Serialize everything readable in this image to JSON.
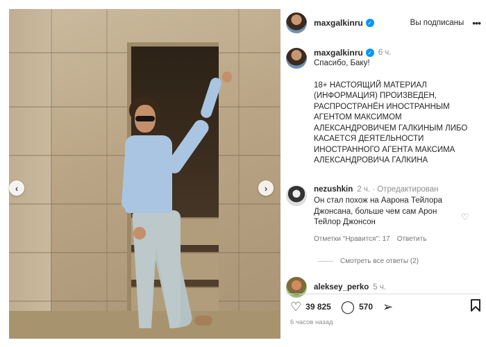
{
  "post": {
    "username": "maxgalkinru",
    "follow_state": "Вы подписаны",
    "caption_time": "6 ч.",
    "caption_line1": "Спасибо, Баку!",
    "caption_warning": "18+ НАСТОЯЩИЙ МАТЕРИАЛ (ИНФОРМАЦИЯ)  ПРОИЗВЕДЕН, РАСПРОСТРАНЁН ИНОСТРАННЫМ АГЕНТОМ МАКСИМОМ АЛЕКСАНДРОВИЧЕМ ГАЛКИНЫМ ЛИБО КАСАЕТСЯ ДЕЯТЕЛЬНОСТИ ИНОСТРАННОГО АГЕНТА МАКСИМА АЛЕКСАНДРОВИЧА ГАЛКИНА",
    "posted_ago": "6 часов назад"
  },
  "comment1": {
    "username": "nezushkin",
    "meta": "2 ч. · Отредактирован",
    "text": "Он стал похож на Аарона Тейлора Джонсана, больше чем сам Арон Тейлор Джонсон",
    "likes_label": "Отметки \"Нравится\": 17",
    "reply_label": "Ответить",
    "view_replies": "Смотреть все ответы (2)"
  },
  "comment2": {
    "username": "aleksey_perko",
    "meta": "5 ч."
  },
  "stats": {
    "likes": "39 825",
    "comments": "570"
  },
  "icons": {
    "verified": "verified-badge-icon",
    "more": "more-options-icon",
    "heart": "heart-icon",
    "comment": "comment-icon",
    "share": "share-icon",
    "save": "bookmark-icon",
    "prev": "chevron-left-icon",
    "next": "chevron-right-icon"
  },
  "colors": {
    "verified": "#0095f6",
    "muted": "#8e8e8e"
  }
}
